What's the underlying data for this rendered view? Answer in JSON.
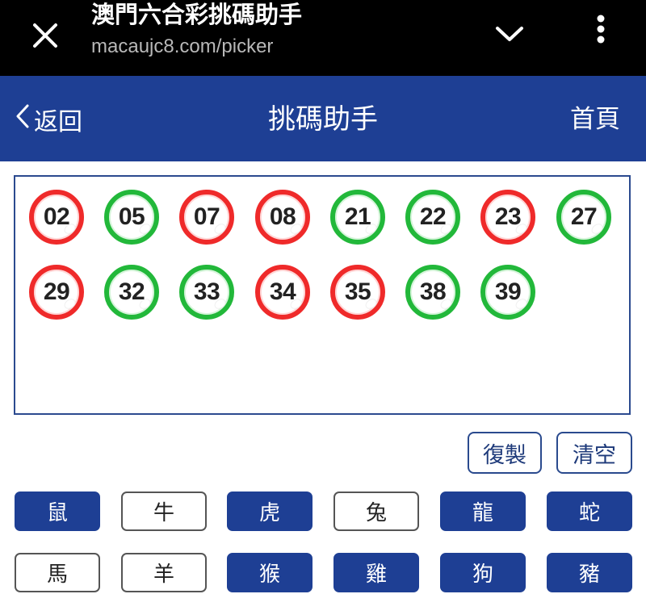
{
  "browser": {
    "title": "澳門六合彩挑碼助手",
    "url": "macaujc8.com/picker",
    "icons": {
      "close": "close-icon",
      "dropdown": "chevron-down-icon",
      "menu": "kebab-menu-icon"
    }
  },
  "header": {
    "back_label": "返回",
    "title": "挑碼助手",
    "home_label": "首頁",
    "bg_color": "#1e3f94"
  },
  "balls": [
    {
      "num": "02",
      "color": "red"
    },
    {
      "num": "05",
      "color": "green"
    },
    {
      "num": "07",
      "color": "red"
    },
    {
      "num": "08",
      "color": "red"
    },
    {
      "num": "21",
      "color": "green"
    },
    {
      "num": "22",
      "color": "green"
    },
    {
      "num": "23",
      "color": "red"
    },
    {
      "num": "27",
      "color": "green"
    },
    {
      "num": "29",
      "color": "red"
    },
    {
      "num": "32",
      "color": "green"
    },
    {
      "num": "33",
      "color": "green"
    },
    {
      "num": "34",
      "color": "red"
    },
    {
      "num": "35",
      "color": "red"
    },
    {
      "num": "38",
      "color": "green"
    },
    {
      "num": "39",
      "color": "green"
    }
  ],
  "actions": {
    "copy_label": "復製",
    "clear_label": "清空"
  },
  "zodiac": [
    {
      "label": "鼠",
      "selected": true
    },
    {
      "label": "牛",
      "selected": false
    },
    {
      "label": "虎",
      "selected": true
    },
    {
      "label": "兔",
      "selected": false
    },
    {
      "label": "龍",
      "selected": true
    },
    {
      "label": "蛇",
      "selected": true
    },
    {
      "label": "馬",
      "selected": false
    },
    {
      "label": "羊",
      "selected": false
    },
    {
      "label": "猴",
      "selected": true
    },
    {
      "label": "雞",
      "selected": true
    },
    {
      "label": "狗",
      "selected": true
    },
    {
      "label": "豬",
      "selected": true
    }
  ],
  "colors": {
    "red": "#ef2a2a",
    "green": "#22b83a",
    "accent": "#1e3f94"
  }
}
